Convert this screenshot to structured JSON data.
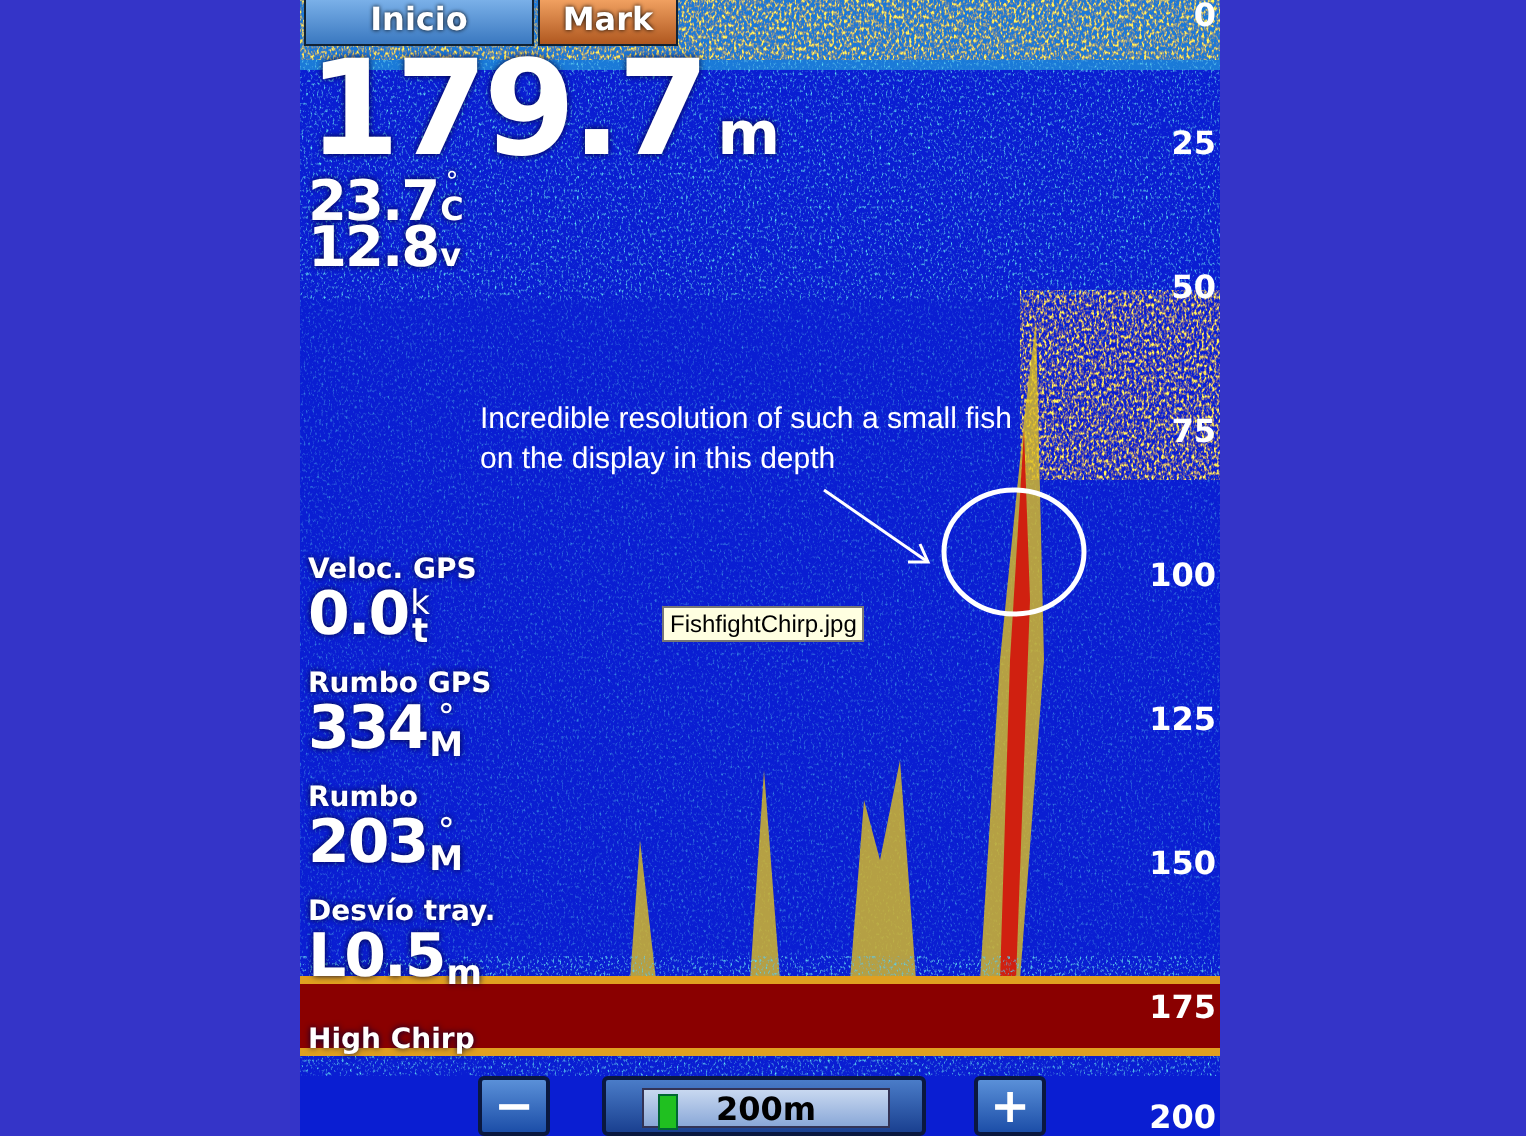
{
  "tabs": [
    {
      "label": "Inicio",
      "kind": "home"
    },
    {
      "label": "Mark",
      "kind": "mark"
    }
  ],
  "depth": {
    "value": "179.7",
    "unit": "m"
  },
  "temperature": {
    "value": "23.7",
    "unit_mark": "°",
    "unit": "C"
  },
  "voltage": {
    "value": "12.8",
    "unit": "v"
  },
  "data_fields": [
    {
      "label": "Veloc. GPS",
      "value": "0.0",
      "unit_mark": "k",
      "unit": "t"
    },
    {
      "label": "Rumbo GPS",
      "value": "334",
      "unit_mark": "°",
      "unit": "M"
    },
    {
      "label": "Rumbo",
      "value": "203",
      "unit_mark": "°",
      "unit": "M"
    },
    {
      "label": "Desvío tray.",
      "value": "L0.5",
      "unit": "m"
    }
  ],
  "annotation": "Incredible resolution of such a small fish on the display in this depth",
  "tooltip": "FishfightChirp.jpg",
  "frequency": "High Chirp",
  "depth_scale": [
    "0",
    "25",
    "50",
    "75",
    "100",
    "125",
    "150",
    "175",
    "200"
  ],
  "range": {
    "value": "200m",
    "level": 0.06
  },
  "zoom_buttons": [
    {
      "symbol": "−"
    },
    {
      "symbol": "+"
    }
  ]
}
